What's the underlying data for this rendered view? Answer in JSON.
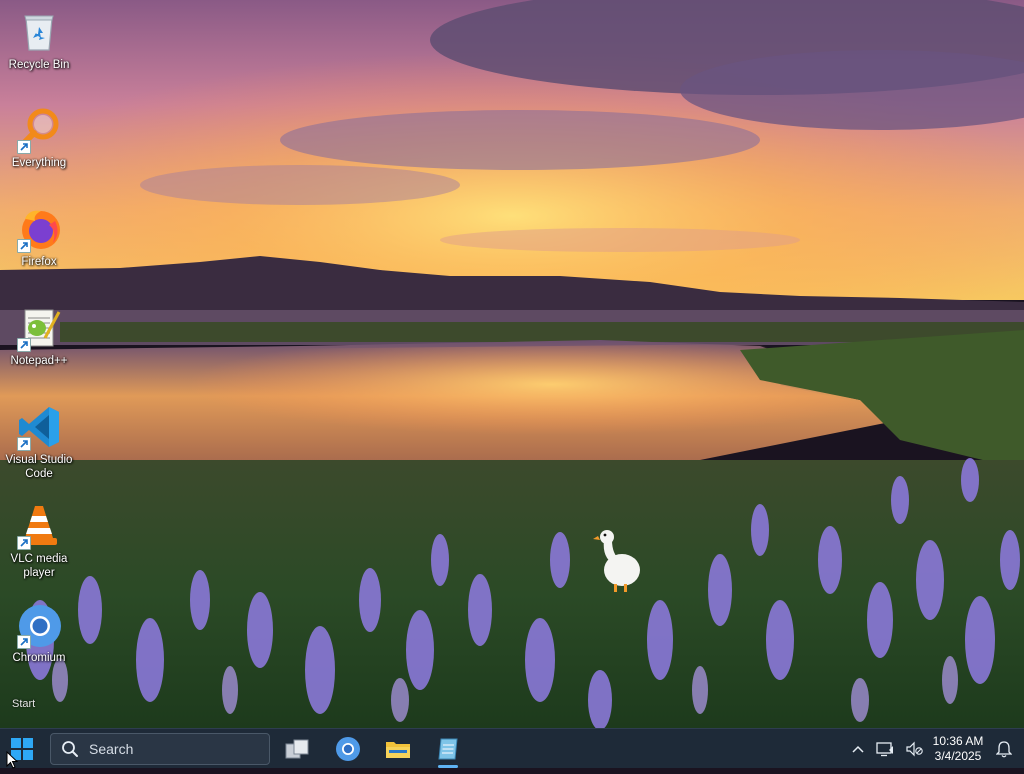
{
  "desktop": {
    "icons": [
      {
        "label": "Recycle Bin",
        "icon": "recycle-bin-icon"
      },
      {
        "label": "Everything",
        "icon": "everything-search-icon"
      },
      {
        "label": "Firefox",
        "icon": "firefox-icon"
      },
      {
        "label": "Notepad++",
        "icon": "notepad-plus-plus-icon"
      },
      {
        "label": "Visual Studio Code",
        "icon": "vscode-icon"
      },
      {
        "label": "VLC media player",
        "icon": "vlc-icon"
      },
      {
        "label": "Chromium",
        "icon": "chromium-icon"
      }
    ],
    "start_hint": "Start"
  },
  "taskbar": {
    "search_placeholder": "Search",
    "pinned": [
      {
        "name": "task-view",
        "icon": "task-view-icon"
      },
      {
        "name": "chromium",
        "icon": "chromium-icon"
      },
      {
        "name": "file-explorer",
        "icon": "folder-icon"
      },
      {
        "name": "notepad",
        "icon": "notepad-icon",
        "active": true
      }
    ],
    "tray": {
      "time": "10:36 AM",
      "date": "3/4/2025"
    },
    "colors": {
      "background": "#1e2a38",
      "accent": "#5fb3f3"
    }
  }
}
